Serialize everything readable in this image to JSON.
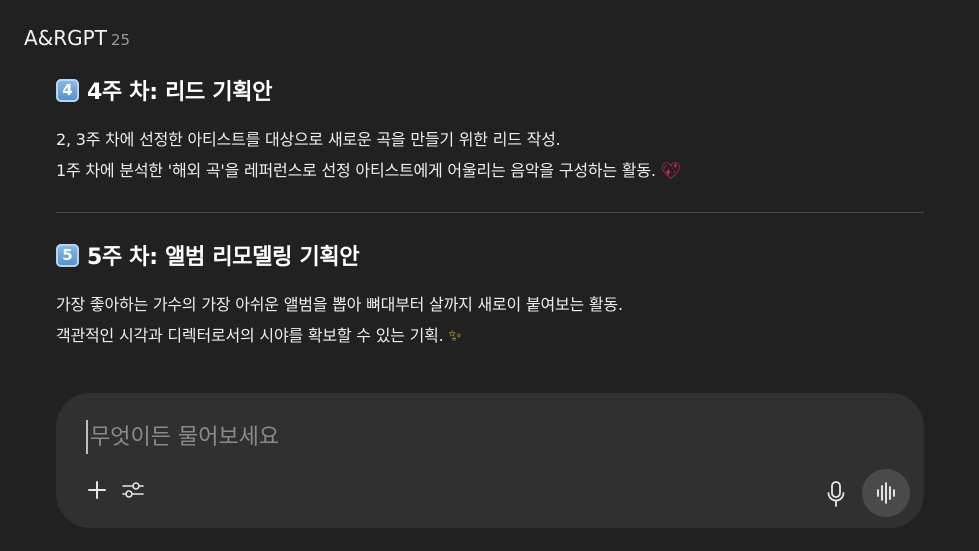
{
  "header": {
    "app_name": "A&RGPT",
    "version": "25"
  },
  "sections": [
    {
      "number": "4",
      "number_icon": "keycap-digit-four-icon",
      "title": "4주 차: 리드 기획안",
      "lines": [
        "2, 3주 차에 선정한 아티스트를 대상으로 새로운 곡을 만들기 위한 리드 작성.",
        "1주 차에 분석한 '해외 곡'을 레퍼런스로 선정 아티스트에게 어울리는 음악을 구성하는 활동."
      ],
      "trailing_emoji": "sparkling-heart-icon"
    },
    {
      "number": "5",
      "number_icon": "keycap-digit-five-icon",
      "title": "5주 차: 앨범 리모델링 기획안",
      "lines": [
        "가장 좋아하는 가수의 가장 아쉬운 앨범을 뽑아 뼈대부터 살까지 새로이 붙여보는 활동.",
        "객관적인 시각과 디렉터로서의 시야를 확보할 수 있는 기획."
      ],
      "trailing_emoji": "sparkles-icon"
    }
  ],
  "composer": {
    "placeholder": "무엇이든 물어보세요",
    "value": "",
    "icons": {
      "add": "plus-icon",
      "tools": "sliders-icon",
      "mic": "microphone-icon",
      "voice": "voice-waveform-icon"
    }
  },
  "colors": {
    "background": "#212121",
    "composer_background": "#303030",
    "text": "#ececec",
    "muted_text": "#9a9a9a",
    "keycap": "#4f8fcb"
  }
}
